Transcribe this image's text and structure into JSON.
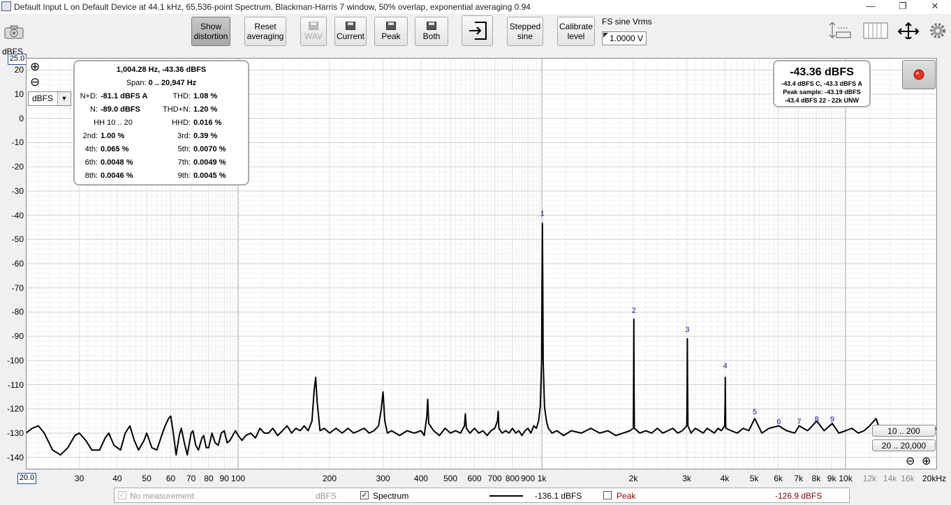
{
  "window": {
    "title": "Default Input L on Default Device at 44.1 kHz, 65,536-point Spectrum, Blackman-Harris 7 window, 50% overlap, exponential averaging 0.94",
    "minimize": "—",
    "maximize": "❐",
    "close": "✕"
  },
  "toolbar": {
    "show_distortion": [
      "Show",
      "distortion"
    ],
    "reset_averaging": [
      "Reset",
      "averaging"
    ],
    "wav": "WAV",
    "current": "Current",
    "peak": "Peak",
    "both": "Both",
    "stepped_sine": [
      "Stepped",
      "sine"
    ],
    "calibrate_level": [
      "Calibrate",
      "level"
    ],
    "fs_label": "FS sine Vrms",
    "fs_value": "1.0000 V"
  },
  "axis": {
    "y_unit": "dBFS",
    "y_top_value": "25.0",
    "x_start_value": "20.0",
    "unit_dropdown": "dBFS",
    "x_unit_suffix": "kHz",
    "zoom_in": "⊕",
    "zoom_out": "⊖"
  },
  "distortion_panel": {
    "header": "1,004.28 Hz, -43.36 dBFS",
    "span_label": "Span:",
    "span_value": "0 .. 20,947 Hz",
    "rows": [
      {
        "l_label": "N+D:",
        "l_value": "-81.1 dBFS A",
        "r_label": "THD:",
        "r_value": "1.08 %"
      },
      {
        "l_label": "N:",
        "l_value": "-89.0 dBFS",
        "r_label": "THD+N:",
        "r_value": "1.20 %"
      },
      {
        "l_label": "HH 10 .. 20",
        "l_value": "",
        "r_label": "HHD:",
        "r_value": "0.016 %"
      },
      {
        "l_label": "2nd:",
        "l_value": "1.00 %",
        "r_label": "3rd:",
        "r_value": "0.39 %"
      },
      {
        "l_label": "4th:",
        "l_value": "0.065 %",
        "r_label": "5th:",
        "r_value": "0.0070 %"
      },
      {
        "l_label": "6th:",
        "l_value": "0.0048 %",
        "r_label": "7th:",
        "r_value": "0.0049 %"
      },
      {
        "l_label": "8th:",
        "l_value": "0.0046 %",
        "r_label": "9th:",
        "r_value": "0.0045 %"
      }
    ]
  },
  "level_panel": {
    "main": "-43.36 dBFS",
    "line1": "-43.4 dBFS C, -43.3 dBFS A",
    "line2": "Peak sample: -43.19 dBFS",
    "line3": "-43.4 dBFS 22 - 22k UNW"
  },
  "range_buttons": [
    "10 .. 200",
    "20 .. 20,000"
  ],
  "bottom_bar": {
    "no_measurement": "No measurement",
    "unit1": "dBFS",
    "spectrum": "Spectrum",
    "spectrum_value": "-136.1 dBFS",
    "peak": "Peak",
    "peak_value": "-126.9 dBFS",
    "peak_color": "#8b0000"
  },
  "chart_data": {
    "type": "line",
    "ylabel": "dBFS",
    "x_scale": "log",
    "xlim": [
      20,
      20000
    ],
    "ylim": [
      -145,
      25
    ],
    "grid": true,
    "x_tick_labels": [
      {
        "f": 20,
        "label": "20.0"
      },
      {
        "f": 30,
        "label": "30"
      },
      {
        "f": 40,
        "label": "40"
      },
      {
        "f": 50,
        "label": "50"
      },
      {
        "f": 60,
        "label": "60"
      },
      {
        "f": 70,
        "label": "70"
      },
      {
        "f": 80,
        "label": "80"
      },
      {
        "f": 90,
        "label": "90"
      },
      {
        "f": 100,
        "label": "100"
      },
      {
        "f": 200,
        "label": "200"
      },
      {
        "f": 300,
        "label": "300"
      },
      {
        "f": 400,
        "label": "400"
      },
      {
        "f": 500,
        "label": "500"
      },
      {
        "f": 600,
        "label": "600"
      },
      {
        "f": 700,
        "label": "700"
      },
      {
        "f": 800,
        "label": "800"
      },
      {
        "f": 900,
        "label": "900"
      },
      {
        "f": 1000,
        "label": "1k"
      },
      {
        "f": 2000,
        "label": "2k"
      },
      {
        "f": 3000,
        "label": "3k"
      },
      {
        "f": 4000,
        "label": "4k"
      },
      {
        "f": 5000,
        "label": "5k"
      },
      {
        "f": 6000,
        "label": "6k"
      },
      {
        "f": 7000,
        "label": "7k"
      },
      {
        "f": 8000,
        "label": "8k"
      },
      {
        "f": 9000,
        "label": "9k"
      },
      {
        "f": 10000,
        "label": "10k"
      },
      {
        "f": 12000,
        "label": "12k"
      },
      {
        "f": 14000,
        "label": "14k"
      },
      {
        "f": 16000,
        "label": "16k"
      },
      {
        "f": 20000,
        "label": "20kHz"
      }
    ],
    "y_ticks": [
      20,
      10,
      0,
      -10,
      -20,
      -30,
      -40,
      -50,
      -60,
      -70,
      -80,
      -90,
      -100,
      -110,
      -120,
      -130,
      -140
    ],
    "harmonic_markers": [
      {
        "label": "1",
        "f": 1004,
        "db": -42
      },
      {
        "label": "2",
        "f": 2008,
        "db": -82
      },
      {
        "label": "3",
        "f": 3013,
        "db": -90
      },
      {
        "label": "4",
        "f": 4017,
        "db": -105
      },
      {
        "label": "5",
        "f": 5021,
        "db": -124
      },
      {
        "label": "6",
        "f": 6026,
        "db": -128
      },
      {
        "label": "7",
        "f": 7030,
        "db": -128
      },
      {
        "label": "8",
        "f": 8034,
        "db": -127
      },
      {
        "label": "9",
        "f": 9038,
        "db": -127
      }
    ],
    "series": [
      {
        "values": [
          [
            20,
            -130
          ],
          [
            21,
            -128
          ],
          [
            22,
            -127
          ],
          [
            23,
            -130
          ],
          [
            24.5,
            -137
          ],
          [
            26,
            -139
          ],
          [
            27.5,
            -136
          ],
          [
            29,
            -131
          ],
          [
            30,
            -130
          ],
          [
            31.5,
            -133
          ],
          [
            33,
            -137
          ],
          [
            35,
            -137
          ],
          [
            36.5,
            -132
          ],
          [
            37.5,
            -130
          ],
          [
            39,
            -135
          ],
          [
            41,
            -137
          ],
          [
            42.5,
            -130
          ],
          [
            44,
            -127
          ],
          [
            45.5,
            -133
          ],
          [
            47,
            -137
          ],
          [
            49,
            -133
          ],
          [
            50,
            -130
          ],
          [
            52,
            -136
          ],
          [
            54,
            -137
          ],
          [
            56,
            -131
          ],
          [
            57.5,
            -127
          ],
          [
            59,
            -124
          ],
          [
            60,
            -123
          ],
          [
            61,
            -129
          ],
          [
            62.5,
            -139
          ],
          [
            64,
            -131
          ],
          [
            65,
            -128
          ],
          [
            66.5,
            -134
          ],
          [
            68,
            -139
          ],
          [
            70,
            -130
          ],
          [
            71,
            -129
          ],
          [
            72.5,
            -135
          ],
          [
            74,
            -137
          ],
          [
            76,
            -132
          ],
          [
            77,
            -131
          ],
          [
            78.5,
            -136
          ],
          [
            80,
            -136
          ],
          [
            82,
            -130
          ],
          [
            84,
            -134
          ],
          [
            86,
            -135
          ],
          [
            88,
            -130
          ],
          [
            90,
            -129
          ],
          [
            92,
            -134
          ],
          [
            94,
            -133
          ],
          [
            96,
            -131
          ],
          [
            98,
            -129
          ],
          [
            100,
            -131
          ],
          [
            103,
            -133
          ],
          [
            106,
            -131
          ],
          [
            110,
            -130
          ],
          [
            114,
            -132
          ],
          [
            118,
            -128
          ],
          [
            122,
            -130
          ],
          [
            126,
            -130
          ],
          [
            130,
            -128
          ],
          [
            135,
            -131
          ],
          [
            140,
            -129
          ],
          [
            145,
            -127
          ],
          [
            150,
            -130
          ],
          [
            155,
            -128
          ],
          [
            160,
            -129
          ],
          [
            165,
            -127
          ],
          [
            170,
            -129
          ],
          [
            175,
            -125
          ],
          [
            178,
            -112
          ],
          [
            180,
            -107
          ],
          [
            182,
            -117
          ],
          [
            186,
            -129
          ],
          [
            192,
            -128
          ],
          [
            200,
            -130
          ],
          [
            210,
            -128
          ],
          [
            220,
            -130
          ],
          [
            230,
            -128
          ],
          [
            240,
            -130
          ],
          [
            250,
            -129
          ],
          [
            260,
            -128
          ],
          [
            270,
            -130
          ],
          [
            280,
            -129
          ],
          [
            290,
            -127
          ],
          [
            296,
            -120
          ],
          [
            300,
            -113
          ],
          [
            304,
            -125
          ],
          [
            310,
            -130
          ],
          [
            320,
            -129
          ],
          [
            340,
            -131
          ],
          [
            360,
            -129
          ],
          [
            380,
            -130
          ],
          [
            400,
            -129
          ],
          [
            410,
            -131
          ],
          [
            418,
            -123
          ],
          [
            421,
            -116
          ],
          [
            424,
            -126
          ],
          [
            440,
            -129
          ],
          [
            460,
            -131
          ],
          [
            480,
            -128
          ],
          [
            500,
            -130
          ],
          [
            520,
            -129
          ],
          [
            540,
            -130
          ],
          [
            556,
            -127
          ],
          [
            560,
            -122
          ],
          [
            564,
            -128
          ],
          [
            580,
            -130
          ],
          [
            600,
            -128
          ],
          [
            620,
            -130
          ],
          [
            640,
            -129
          ],
          [
            660,
            -131
          ],
          [
            680,
            -129
          ],
          [
            700,
            -128
          ],
          [
            714,
            -125
          ],
          [
            718,
            -121
          ],
          [
            722,
            -128
          ],
          [
            740,
            -130
          ],
          [
            760,
            -129
          ],
          [
            780,
            -130
          ],
          [
            800,
            -128
          ],
          [
            820,
            -130
          ],
          [
            840,
            -129
          ],
          [
            860,
            -131
          ],
          [
            880,
            -129
          ],
          [
            900,
            -128
          ],
          [
            920,
            -130
          ],
          [
            940,
            -127
          ],
          [
            960,
            -128
          ],
          [
            975,
            -125
          ],
          [
            988,
            -119
          ],
          [
            998,
            -100
          ],
          [
            1001,
            -70
          ],
          [
            1004,
            -43.4
          ],
          [
            1007,
            -70
          ],
          [
            1010,
            -100
          ],
          [
            1020,
            -119
          ],
          [
            1035,
            -125
          ],
          [
            1050,
            -128
          ],
          [
            1080,
            -130
          ],
          [
            1120,
            -129
          ],
          [
            1180,
            -131
          ],
          [
            1250,
            -129
          ],
          [
            1350,
            -130
          ],
          [
            1450,
            -128
          ],
          [
            1550,
            -130
          ],
          [
            1650,
            -129
          ],
          [
            1750,
            -131
          ],
          [
            1850,
            -130
          ],
          [
            1950,
            -129
          ],
          [
            2000,
            -128
          ],
          [
            2004,
            -110
          ],
          [
            2008,
            -83
          ],
          [
            2012,
            -110
          ],
          [
            2016,
            -128
          ],
          [
            2100,
            -130
          ],
          [
            2200,
            -129
          ],
          [
            2300,
            -130
          ],
          [
            2400,
            -128
          ],
          [
            2500,
            -130
          ],
          [
            2600,
            -129
          ],
          [
            2700,
            -128
          ],
          [
            2800,
            -130
          ],
          [
            2900,
            -129
          ],
          [
            3000,
            -127
          ],
          [
            3009,
            -108
          ],
          [
            3013,
            -91
          ],
          [
            3017,
            -108
          ],
          [
            3026,
            -127
          ],
          [
            3100,
            -130
          ],
          [
            3200,
            -128
          ],
          [
            3300,
            -129
          ],
          [
            3400,
            -130
          ],
          [
            3500,
            -128
          ],
          [
            3600,
            -129
          ],
          [
            3700,
            -130
          ],
          [
            3800,
            -128
          ],
          [
            3900,
            -129
          ],
          [
            4000,
            -127
          ],
          [
            4013,
            -115
          ],
          [
            4017,
            -107
          ],
          [
            4021,
            -115
          ],
          [
            4030,
            -128
          ],
          [
            4200,
            -129
          ],
          [
            4400,
            -130
          ],
          [
            4600,
            -128
          ],
          [
            4800,
            -129
          ],
          [
            5021,
            -124
          ],
          [
            5300,
            -130
          ],
          [
            5600,
            -128
          ],
          [
            6026,
            -127
          ],
          [
            6400,
            -129
          ],
          [
            6800,
            -130
          ],
          [
            7030,
            -127
          ],
          [
            7500,
            -129
          ],
          [
            8034,
            -125
          ],
          [
            8500,
            -129
          ],
          [
            9038,
            -126
          ],
          [
            9500,
            -130
          ],
          [
            10000,
            -129
          ],
          [
            10500,
            -128
          ],
          [
            11000,
            -130
          ],
          [
            11500,
            -129
          ],
          [
            12000,
            -127
          ],
          [
            12600,
            -124
          ],
          [
            13000,
            -129
          ],
          [
            14000,
            -130
          ],
          [
            15000,
            -128
          ],
          [
            16000,
            -129
          ],
          [
            17000,
            -130
          ],
          [
            18000,
            -128
          ],
          [
            19000,
            -129
          ],
          [
            20000,
            -128
          ]
        ]
      }
    ]
  }
}
